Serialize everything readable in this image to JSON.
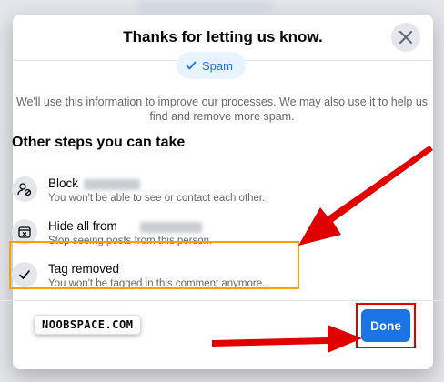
{
  "dialog": {
    "title": "Thanks for letting us know.",
    "chip_label": "Spam",
    "info_text": "We'll use this information to improve our processes. We may also use it to help us find and remove more spam.",
    "section_title": "Other steps you can take",
    "steps": [
      {
        "title": "Block",
        "subtitle": "You won't be able to see or contact each other.",
        "icon": "block-user-icon"
      },
      {
        "title": "Hide all from",
        "subtitle": "Stop seeing posts from this person.",
        "icon": "hide-icon"
      },
      {
        "title": "Tag removed",
        "subtitle": "You won't be tagged in this comment anymore.",
        "icon": "checkmark-icon"
      }
    ],
    "done_label": "Done"
  },
  "watermark": "NOOBSPACE.COM",
  "colors": {
    "accent": "#1b74e4",
    "highlight_box": "#f0a30a",
    "annotation_red": "#e00000"
  }
}
